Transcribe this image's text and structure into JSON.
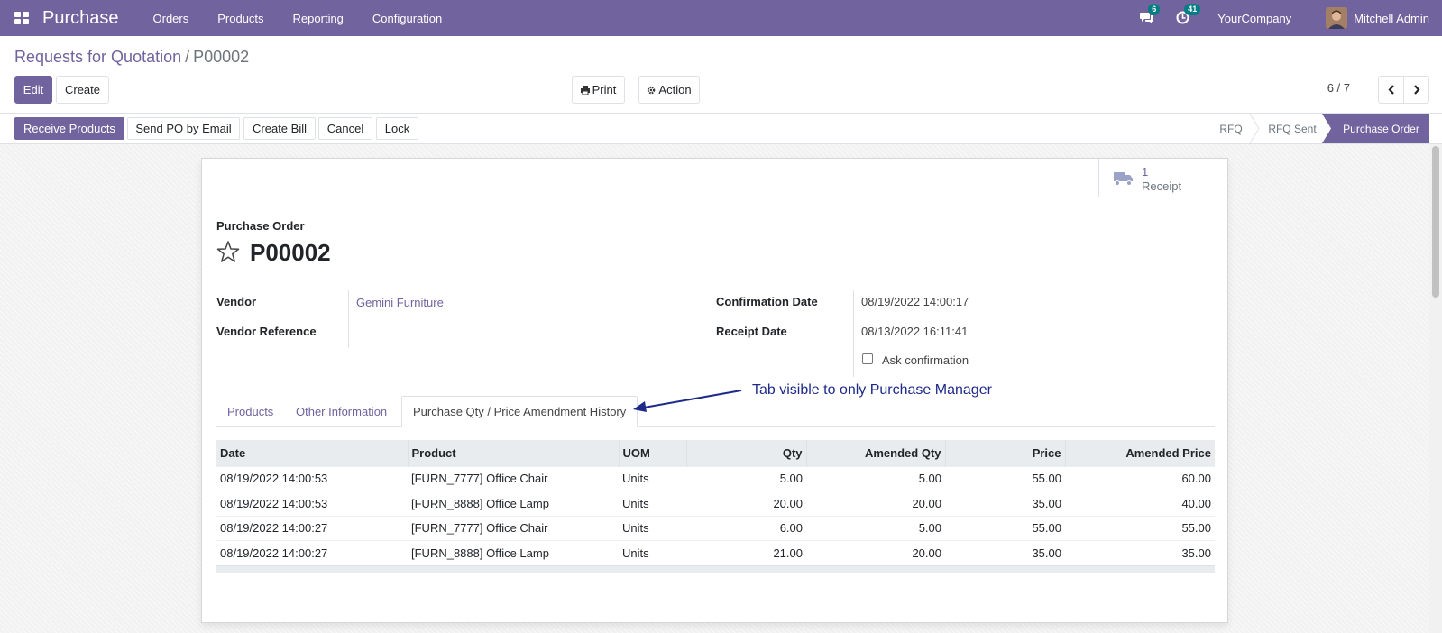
{
  "app": {
    "title": "Purchase",
    "menu": [
      "Orders",
      "Products",
      "Reporting",
      "Configuration"
    ],
    "messages_count": "6",
    "activities_count": "41",
    "company": "YourCompany",
    "user": "Mitchell Admin"
  },
  "breadcrumb": {
    "parent": "Requests for Quotation",
    "separator": "/",
    "current": "P00002"
  },
  "toolbar": {
    "edit": "Edit",
    "create": "Create",
    "print": "Print",
    "action": "Action",
    "pager": "6 / 7"
  },
  "statusbar": {
    "buttons": [
      "Receive Products",
      "Send PO by Email",
      "Create Bill",
      "Cancel",
      "Lock"
    ],
    "stages": [
      "RFQ",
      "RFQ Sent",
      "Purchase Order"
    ],
    "active_stage": "Purchase Order"
  },
  "smart_button": {
    "count": "1",
    "label": "Receipt"
  },
  "form": {
    "doc_type": "Purchase Order",
    "name": "P00002",
    "vendor_label": "Vendor",
    "vendor_value": "Gemini Furniture",
    "vendor_ref_label": "Vendor Reference",
    "confirmation_date_label": "Confirmation Date",
    "confirmation_date_value": "08/19/2022 14:00:17",
    "receipt_date_label": "Receipt Date",
    "receipt_date_value": "08/13/2022 16:11:41",
    "ask_confirmation_label": "Ask confirmation",
    "ask_confirmation_checked": false
  },
  "tabs": [
    "Products",
    "Other Information",
    "Purchase Qty / Price Amendment History"
  ],
  "active_tab": "Purchase Qty / Price Amendment History",
  "annotation": "Tab visible to only Purchase Manager",
  "amendment_table": {
    "headers": [
      "Date",
      "Product",
      "UOM",
      "Qty",
      "Amended Qty",
      "Price",
      "Amended Price"
    ],
    "rows": [
      [
        "08/19/2022 14:00:53",
        "[FURN_7777] Office Chair",
        "Units",
        "5.00",
        "5.00",
        "55.00",
        "60.00"
      ],
      [
        "08/19/2022 14:00:53",
        "[FURN_8888] Office Lamp",
        "Units",
        "20.00",
        "20.00",
        "35.00",
        "40.00"
      ],
      [
        "08/19/2022 14:00:27",
        "[FURN_7777] Office Chair",
        "Units",
        "6.00",
        "5.00",
        "55.00",
        "55.00"
      ],
      [
        "08/19/2022 14:00:27",
        "[FURN_8888] Office Lamp",
        "Units",
        "21.00",
        "20.00",
        "35.00",
        "35.00"
      ]
    ]
  },
  "colors": {
    "brand": "#71639e",
    "badge": "#017e84",
    "annotation": "#1d2a8a"
  }
}
